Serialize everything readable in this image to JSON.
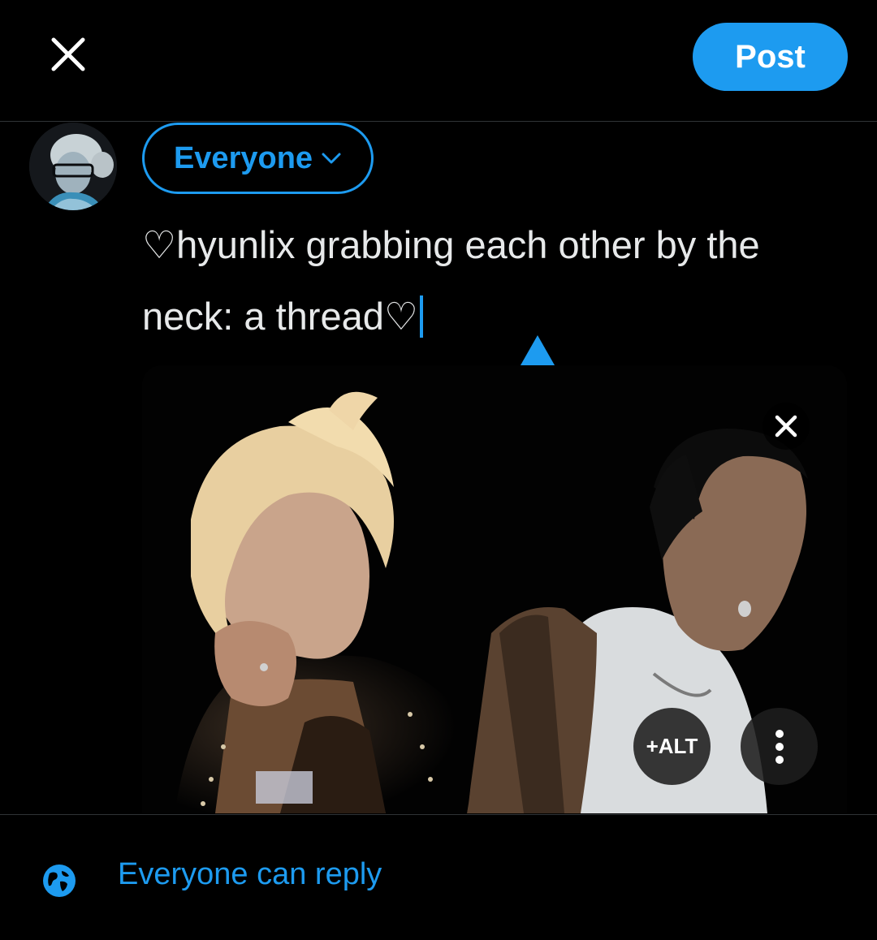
{
  "header": {
    "close_icon": "close-icon",
    "post_label": "Post",
    "accent_color": "#1d9bf0"
  },
  "composer": {
    "avatar_icon": "user-avatar",
    "audience_label": "Everyone",
    "audience_icon": "chevron-down-icon",
    "text": "♡hyunlix grabbing each other by the neck: a thread♡"
  },
  "media": {
    "remove_icon": "close-icon",
    "alt_label": "+ALT",
    "more_icon": "more-vertical-icon"
  },
  "footer": {
    "reply_icon": "globe-icon",
    "reply_label": "Everyone can reply"
  }
}
